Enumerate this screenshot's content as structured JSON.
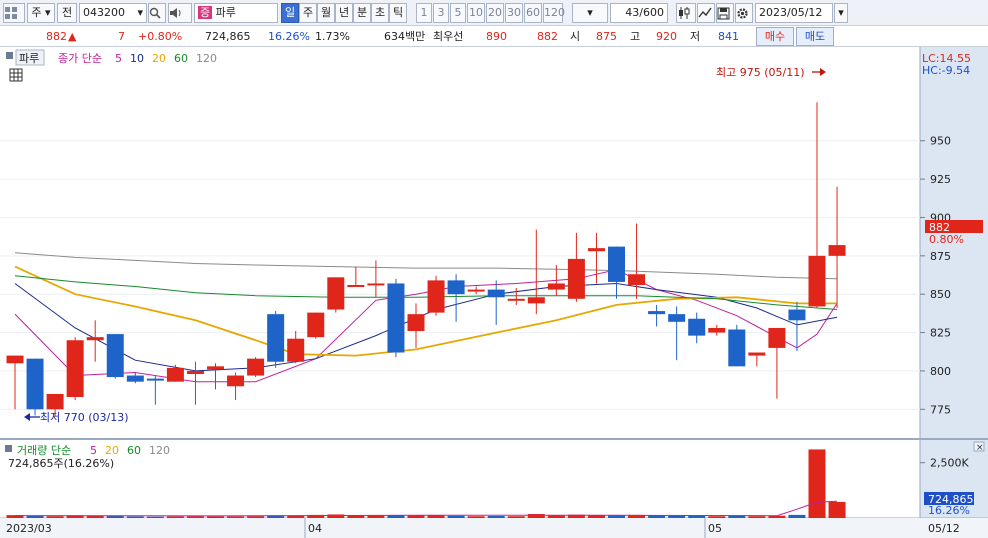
{
  "toolbar": {
    "menu_icon": "grid-icon",
    "market": "주",
    "prev": "전",
    "code": "043200",
    "search_icon": "search-icon",
    "speaker_icon": "speaker-icon",
    "badge": "증",
    "name": "파루",
    "periods": [
      "일",
      "주",
      "월",
      "년",
      "분",
      "초",
      "틱"
    ],
    "active_period": "일",
    "intervals": [
      "1",
      "3",
      "5",
      "10",
      "20",
      "30",
      "60",
      "120"
    ],
    "count": "43/600",
    "date": "2023/05/12"
  },
  "quote": {
    "price": "882",
    "change": "7",
    "change_pct": "+0.80%",
    "volume": "724,865",
    "volume_ratio": "16.26%",
    "turnover_rate": "1.73%",
    "amount": "634백만",
    "best_label": "최우선",
    "ask": "890",
    "bid": "882",
    "open_label": "시",
    "open": "875",
    "high_label": "고",
    "high": "920",
    "low_label": "저",
    "low": "841",
    "buy_button": "매수",
    "sell_button": "매도"
  },
  "price_panel": {
    "tab": "파루",
    "legend_prefix": "종가 단순",
    "ma_labels": [
      "5",
      "10",
      "20",
      "60",
      "120"
    ],
    "ma_colors": [
      "#c0209a",
      "#1b2a88",
      "#e6a800",
      "#178a2a",
      "#8a8a8a"
    ],
    "lc": "LC:14.55",
    "hc": "HC:-9.54",
    "high_annotation": "최고 975 (05/11)",
    "low_annotation": "최저 770 (03/13)",
    "price_tag": "882",
    "pct_tag": "0.80%"
  },
  "volume_panel": {
    "legend_prefix": "거래량 단순",
    "ma_labels": [
      "5",
      "20",
      "60",
      "120"
    ],
    "volume_text": "724,865주(16.26%)",
    "vol_tag": "724,865",
    "pct_tag": "16.26%"
  },
  "x_axis": {
    "labels": [
      "2023/03",
      "04",
      "05",
      "05/12"
    ]
  },
  "colors": {
    "up": "#e0261b",
    "down": "#1e64c8",
    "axis_bg": "#dce6f3"
  },
  "chart_data": [
    {
      "type": "candlestick",
      "title": "",
      "ylim": [
        755,
        985
      ],
      "y_ticks": [
        775,
        800,
        825,
        850,
        875,
        900,
        925,
        950
      ],
      "ohlc": [
        [
          805,
          810,
          775,
          810
        ],
        [
          808,
          808,
          771,
          775
        ],
        [
          775,
          785,
          770,
          785
        ],
        [
          783,
          822,
          781,
          820
        ],
        [
          820,
          833,
          806,
          822
        ],
        [
          824,
          824,
          795,
          796
        ],
        [
          797,
          799,
          792,
          793
        ],
        [
          795,
          797,
          778,
          794
        ],
        [
          793,
          804,
          793,
          802
        ],
        [
          798,
          806,
          778,
          800
        ],
        [
          801,
          805,
          788,
          803
        ],
        [
          790,
          799,
          781,
          797
        ],
        [
          797,
          809,
          796,
          808
        ],
        [
          837,
          839,
          802,
          806
        ],
        [
          806,
          826,
          805,
          821
        ],
        [
          822,
          838,
          821,
          838
        ],
        [
          840,
          861,
          838,
          861
        ],
        [
          855,
          868,
          855,
          856
        ],
        [
          857,
          872,
          848,
          857
        ],
        [
          857,
          860,
          809,
          812
        ],
        [
          826,
          844,
          815,
          837
        ],
        [
          838,
          862,
          836,
          859
        ],
        [
          859,
          863,
          832,
          850
        ],
        [
          853,
          855,
          850,
          853
        ],
        [
          853,
          859,
          830,
          848
        ],
        [
          846,
          854,
          843,
          847
        ],
        [
          844,
          892,
          837,
          848
        ],
        [
          853,
          869,
          849,
          857
        ],
        [
          847,
          890,
          845,
          873
        ],
        [
          878,
          890,
          857,
          880
        ],
        [
          881,
          881,
          847,
          858
        ],
        [
          856,
          896,
          847,
          863
        ],
        [
          839,
          843,
          829,
          837
        ],
        [
          837,
          842,
          807,
          832
        ],
        [
          834,
          838,
          818,
          823
        ],
        [
          825,
          830,
          823,
          828
        ],
        [
          827,
          830,
          803,
          803
        ],
        [
          810,
          810,
          803,
          812
        ],
        [
          815,
          816,
          782,
          828
        ],
        [
          840,
          845,
          813,
          833
        ],
        [
          842,
          975,
          841,
          875
        ],
        [
          875,
          920,
          841,
          882
        ]
      ],
      "ma_series": [
        {
          "name": "5",
          "color": "#c0209a",
          "points": [
            [
              0,
              837
            ],
            [
              3,
              797
            ],
            [
              6,
              799
            ],
            [
              9,
              793
            ],
            [
              12,
              793
            ],
            [
              15,
              808
            ],
            [
              18,
              846
            ],
            [
              20,
              850
            ],
            [
              22,
              855
            ],
            [
              25,
              857
            ],
            [
              28,
              860
            ],
            [
              30,
              866
            ],
            [
              32,
              853
            ],
            [
              34,
              846
            ],
            [
              36,
              836
            ],
            [
              38,
              822
            ],
            [
              39,
              815
            ],
            [
              40,
              824
            ],
            [
              41,
              844
            ]
          ]
        },
        {
          "name": "10",
          "color": "#1b2a88",
          "points": [
            [
              0,
              857
            ],
            [
              3,
              828
            ],
            [
              6,
              807
            ],
            [
              9,
              800
            ],
            [
              12,
              802
            ],
            [
              15,
              808
            ],
            [
              18,
              823
            ],
            [
              21,
              840
            ],
            [
              24,
              850
            ],
            [
              27,
              855
            ],
            [
              30,
              857
            ],
            [
              32,
              853
            ],
            [
              35,
              848
            ],
            [
              37,
              841
            ],
            [
              39,
              830
            ],
            [
              41,
              835
            ]
          ]
        },
        {
          "name": "20",
          "color": "#e6a800",
          "points": [
            [
              0,
              868
            ],
            [
              3,
              850
            ],
            [
              6,
              842
            ],
            [
              9,
              833
            ],
            [
              12,
              820
            ],
            [
              14,
              811
            ],
            [
              17,
              810
            ],
            [
              20,
              814
            ],
            [
              24,
              825
            ],
            [
              27,
              833
            ],
            [
              30,
              843
            ],
            [
              33,
              847
            ],
            [
              36,
              848
            ],
            [
              39,
              844
            ],
            [
              41,
              844
            ]
          ]
        },
        {
          "name": "60",
          "color": "#178a2a",
          "points": [
            [
              0,
              862
            ],
            [
              3,
              858
            ],
            [
              6,
              855
            ],
            [
              9,
              851
            ],
            [
              12,
              849
            ],
            [
              16,
              848
            ],
            [
              20,
              848
            ],
            [
              24,
              849
            ],
            [
              28,
              849
            ],
            [
              31,
              849
            ],
            [
              35,
              847
            ],
            [
              38,
              843
            ],
            [
              41,
              840
            ]
          ]
        },
        {
          "name": "120",
          "color": "#8a8a8a",
          "points": [
            [
              0,
              877
            ],
            [
              3,
              874
            ],
            [
              6,
              872
            ],
            [
              9,
              870
            ],
            [
              12,
              869
            ],
            [
              16,
              868
            ],
            [
              20,
              867
            ],
            [
              24,
              867
            ],
            [
              28,
              866
            ],
            [
              31,
              865
            ],
            [
              35,
              863
            ],
            [
              38,
              861
            ],
            [
              41,
              860
            ]
          ]
        }
      ]
    },
    {
      "type": "bar",
      "title": "",
      "ylim": [
        0,
        3300
      ],
      "y_ticks": [
        2500
      ],
      "y_tick_labels": [
        "2,500K"
      ],
      "values": [
        130,
        90,
        80,
        120,
        110,
        90,
        70,
        60,
        70,
        80,
        75,
        70,
        80,
        120,
        100,
        140,
        160,
        120,
        110,
        120,
        110,
        130,
        100,
        80,
        90,
        80,
        180,
        110,
        150,
        130,
        110,
        140,
        120,
        110,
        90,
        80,
        120,
        80,
        100,
        140,
        3100,
        725
      ],
      "ma_series": [
        {
          "name": "5",
          "color": "#c0209a",
          "points": [
            [
              0,
              110
            ],
            [
              10,
              95
            ],
            [
              20,
              125
            ],
            [
              30,
              120
            ],
            [
              38,
              105
            ],
            [
              39,
              400
            ],
            [
              40,
              720
            ],
            [
              41,
              760
            ]
          ]
        }
      ]
    }
  ]
}
